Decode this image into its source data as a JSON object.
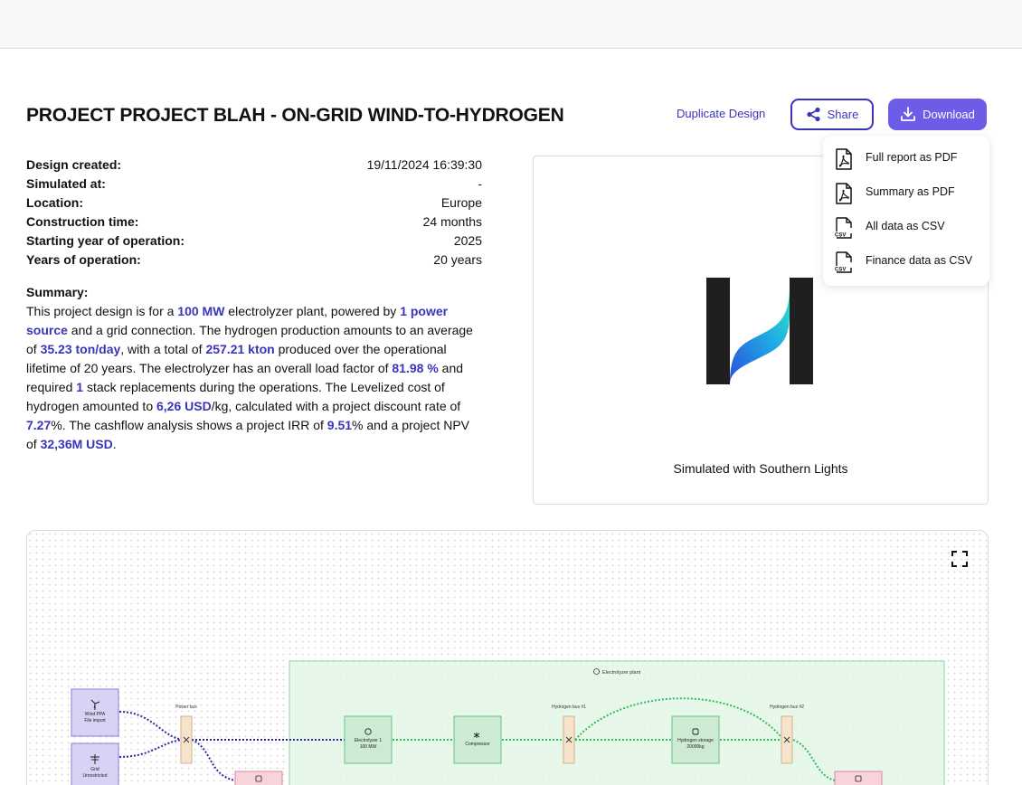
{
  "header": {
    "title": "PROJECT PROJECT BLAH - ON-GRID WIND-TO-HYDROGEN",
    "duplicate_label": "Duplicate Design",
    "share_label": "Share",
    "download_label": "Download"
  },
  "download_menu": {
    "items": [
      {
        "label": "Full report as PDF",
        "icon": "pdf-icon"
      },
      {
        "label": "Summary as PDF",
        "icon": "pdf-icon"
      },
      {
        "label": "All data as CSV",
        "icon": "csv-icon"
      },
      {
        "label": "Finance data as CSV",
        "icon": "csv-icon"
      }
    ],
    "csv_tag": "CSV"
  },
  "meta": [
    {
      "key": "Design created:",
      "value": "19/11/2024 16:39:30"
    },
    {
      "key": "Simulated at:",
      "value": "-"
    },
    {
      "key": "Location:",
      "value": "Europe"
    },
    {
      "key": "Construction time:",
      "value": "24 months"
    },
    {
      "key": "Starting year of operation:",
      "value": "2025"
    },
    {
      "key": "Years of operation:",
      "value": "20 years"
    }
  ],
  "summary": {
    "heading": "Summary:",
    "t1": "This project design is for a ",
    "v_capacity": "100 MW",
    "t2": " electrolyzer plant, powered by ",
    "v_sources": "1 power source",
    "t3": " and a grid connection. The hydrogen production amounts to an average of ",
    "v_daily": "35.23 ton/day",
    "t4": ", with a total of ",
    "v_total": "257.21 kton",
    "t5": " produced over the operational lifetime of 20 years. The electrolyzer has an overall load factor of ",
    "v_load": "81.98 %",
    "t6": " and required ",
    "v_stacks": "1",
    "t7": " stack replacements during the operations. The Levelized cost of hydrogen amounted to ",
    "v_lcoh": "6,26 USD",
    "t8": "/kg, calculated with a project discount rate of ",
    "v_discount": "7.27",
    "t9": "%. The cashflow analysis shows a project IRR of ",
    "v_irr": "9.51",
    "t10": "% and a project NPV of ",
    "v_npv": "32,36M USD",
    "t11": "."
  },
  "logo_card": {
    "caption": "Simulated with Southern Lights"
  },
  "diagram": {
    "plant_label": "Electrolyzer plant",
    "power_bus": "Power bus",
    "h2_bus1": "Hydrogen bus #1",
    "h2_bus2": "Hydrogen bus #2",
    "wind": {
      "line1": "Wind PPA",
      "line2": "File import"
    },
    "grid": {
      "line1": "Grid",
      "line2": "Unrestricted"
    },
    "electrolyzer": {
      "line1": "Electrolyzer 1",
      "line2": "100 MW"
    },
    "compressor": {
      "line1": "Compressor"
    },
    "storage": {
      "line1": "Hydrogen storage",
      "line2": "20000kg"
    }
  },
  "colors": {
    "accent": "#3a35b8",
    "download_bg": "#6c5ce7",
    "plant_fill": "#e3f7e8",
    "plant_border": "#8fd6a4",
    "green_link": "#2ebd5a",
    "blue_link": "#2e2a9a",
    "source_fill": "#d9d2f5",
    "bus_fill": "#f6e3cc",
    "node_fill": "#cdebd3",
    "sink_fill": "#f8d3dc"
  }
}
